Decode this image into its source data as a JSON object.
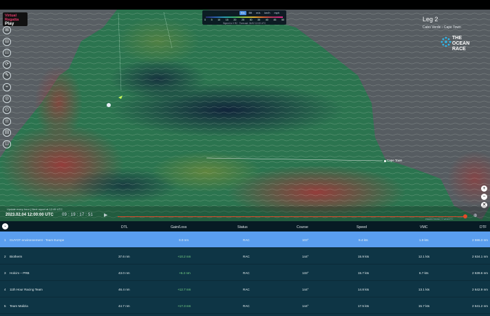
{
  "logo": {
    "line1": "Virtual",
    "line2": "Regatta",
    "line3": "Play"
  },
  "tools": [
    "⊞",
    "⊟",
    "☷",
    "⟳",
    "✎",
    "⌁",
    "◎",
    "◴",
    "☰",
    "▤",
    "⊡"
  ],
  "scale": {
    "units": [
      "Kts",
      "Bft",
      "m/s",
      "km/h",
      "mph"
    ],
    "active_unit": "Kts",
    "ticks": [
      "0",
      "5",
      "10",
      "15",
      "20",
      "25",
      "30",
      "35",
      "40",
      "45",
      "50"
    ],
    "note": "Signed to 0 R2 · Forecast: 04/02 12:00 UTC"
  },
  "header": {
    "leg": "Leg 2",
    "route": "Cabo Verde › Cape Town",
    "brand": [
      "THE",
      "OCEAN",
      "RACE"
    ]
  },
  "map": {
    "city": "Cape Town"
  },
  "zoom": [
    "+",
    "−",
    "✕"
  ],
  "timeline": {
    "note": "Update every hour | Next report at 12:45 UTC",
    "date": "2023.02.04 12:00:00 UTC",
    "clock": "09 : 19 : 17 : 51",
    "credit": "PREDICTWIND | © WINDYTY",
    "play": "▶"
  },
  "table": {
    "toggle": "⌄",
    "columns": [
      "DTL",
      "Gain/Loss",
      "Status",
      "Course",
      "Speed",
      "VMC",
      "DTF"
    ],
    "rows": [
      {
        "idx": "1",
        "team": "GUYOT environnement - Team Europe",
        "dtl": "",
        "gain": "0.0 nm",
        "status": "RAC",
        "course": "103°",
        "speed": "9.4 kts",
        "vmc": "1.9 kts",
        "dtf": "2 596.3 nm",
        "selected": true
      },
      {
        "idx": "2",
        "team": "Biotherm",
        "dtl": "37.6 nm",
        "gain": "+10.2 nm",
        "status": "RAC",
        "course": "144°",
        "speed": "15.9 kts",
        "vmc": "12.1 kts",
        "dtf": "2 634.1 nm",
        "selected": false
      },
      {
        "idx": "3",
        "team": "Holcim – PRB",
        "dtl": "43.0 nm",
        "gain": "+6.2 nm",
        "status": "RAC",
        "course": "133°",
        "speed": "15.7 kts",
        "vmc": "6.7 kts",
        "dtf": "2 639.6 nm",
        "selected": false
      },
      {
        "idx": "4",
        "team": "11th Hour Racing Team",
        "dtl": "46.4 nm",
        "gain": "+12.7 nm",
        "status": "RAC",
        "course": "144°",
        "speed": "14.8 kts",
        "vmc": "13.1 kts",
        "dtf": "2 642.9 nm",
        "selected": false
      },
      {
        "idx": "5",
        "team": "Team Malizia",
        "dtl": "44.7 nm",
        "gain": "+17.3 nm",
        "status": "RAC",
        "course": "144°",
        "speed": "17.5 kts",
        "vmc": "15.7 kts",
        "dtf": "2 641.2 nm",
        "selected": false
      }
    ]
  }
}
